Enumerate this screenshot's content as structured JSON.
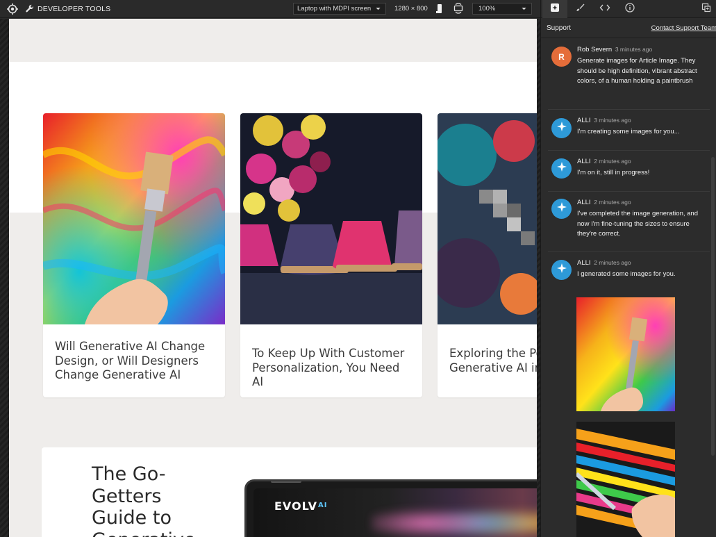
{
  "toolbar": {
    "title": "DEVELOPER TOOLS",
    "device": "Laptop with MDPI screen",
    "resolution": "1280 × 800",
    "zoom": "100%"
  },
  "cards": [
    {
      "title": "Will Generative AI Change Design, or Will Designers Change Generative AI"
    },
    {
      "title": "To Keep Up With Customer Personalization, You Need AI"
    },
    {
      "title": "Exploring the Po Generative AI in"
    }
  ],
  "bottom": {
    "heading": "The Go-Getters Guide to Generative",
    "brand": "EVOLV",
    "brand_suffix": "AI"
  },
  "panel": {
    "header_title": "Support",
    "contact_link": "Contact Support Team",
    "messages": [
      {
        "author": "Rob Severn",
        "avatar_letter": "R",
        "time": "3 minutes ago",
        "text": "Generate images for Article Image. They should be high definition, vibrant abstract colors, of a human holding a paintbrush"
      },
      {
        "author": "ALLI",
        "time": "3 minutes ago",
        "text": "I'm creating some images for you..."
      },
      {
        "author": "ALLI",
        "time": "2 minutes ago",
        "text": "I'm on it, still in progress!"
      },
      {
        "author": "ALLI",
        "time": "2 minutes ago",
        "text": "I've completed the image generation, and now I'm fine-tuning the sizes to ensure they're correct."
      },
      {
        "author": "ALLI",
        "time": "2 minutes ago",
        "text": "I generated some images for you."
      }
    ]
  },
  "colors": {
    "accent_orange": "#e56d3a",
    "alli_blue": "#2e9ad8",
    "panel_bg": "#2c2c2c",
    "page_bg": "#efedeb"
  }
}
